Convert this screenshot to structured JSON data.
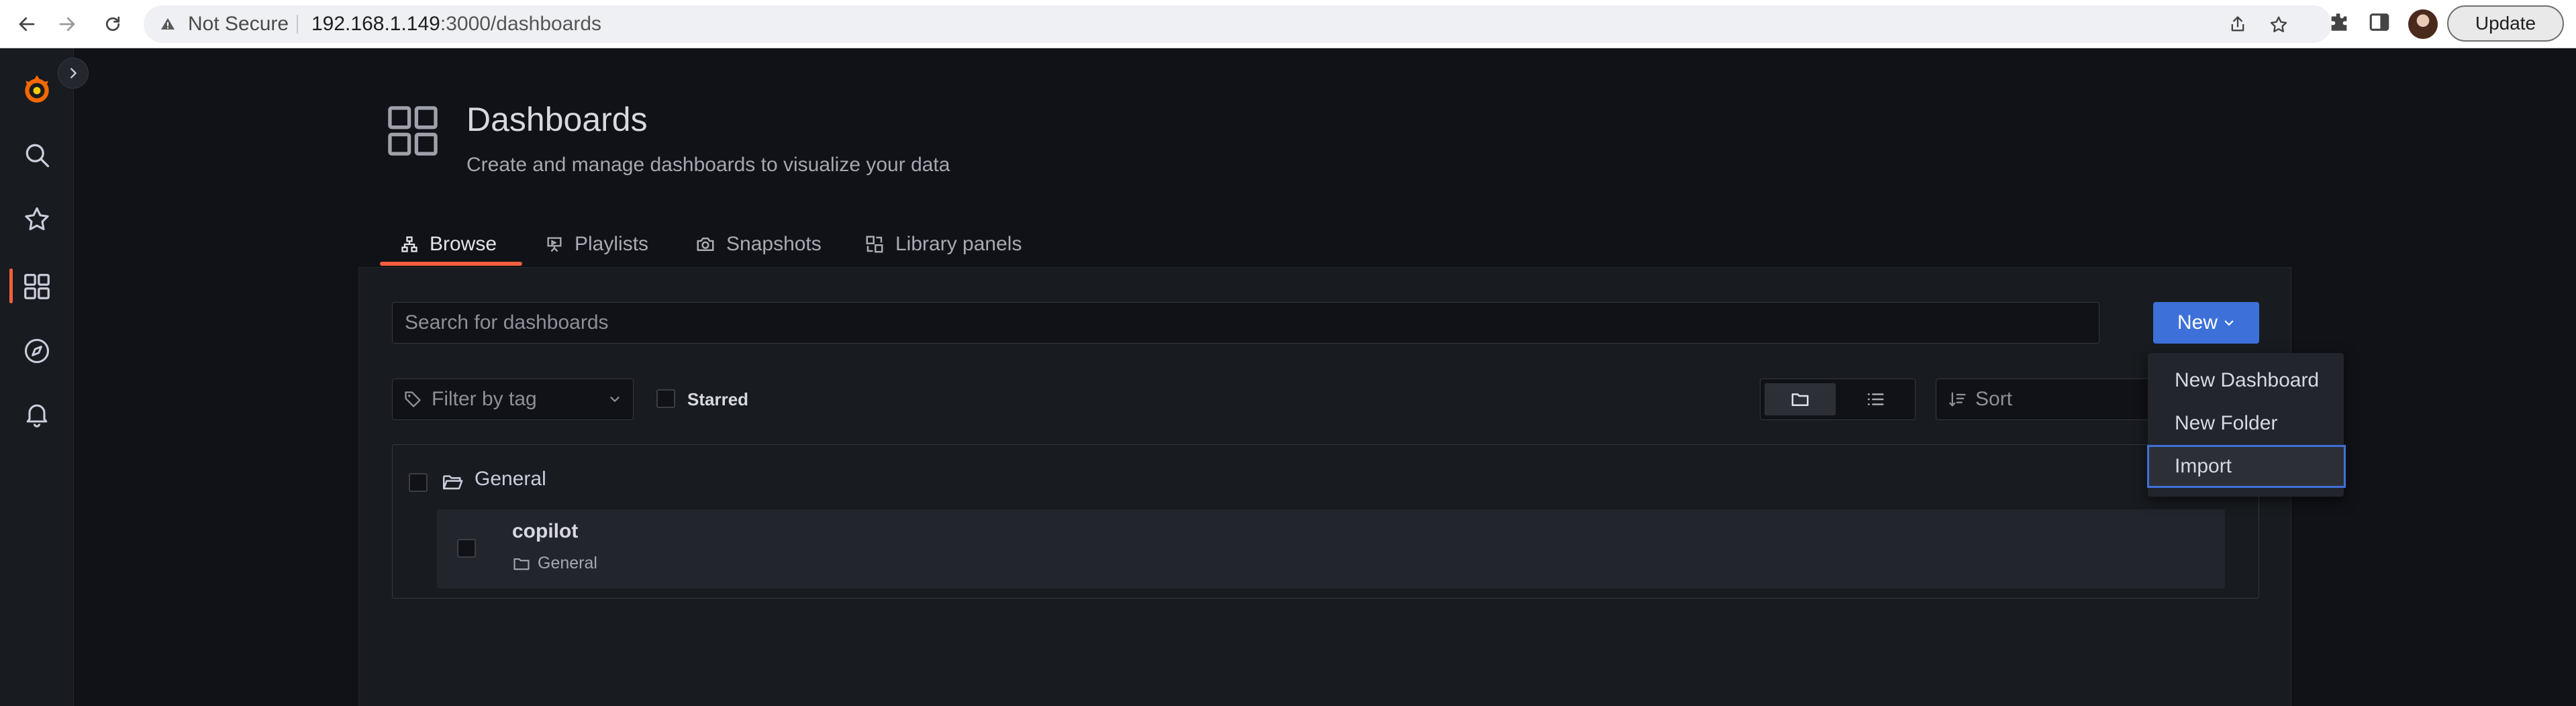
{
  "browser": {
    "security_label": "Not Secure",
    "url_host": "192.168.1.149",
    "url_path": ":3000/dashboards",
    "update_label": "Update",
    "icons": [
      "back-icon",
      "forward-icon",
      "reload-icon",
      "warning-icon",
      "share-icon",
      "star-icon",
      "extensions-icon",
      "sidepanel-icon",
      "profile-avatar"
    ]
  },
  "sidebar": {
    "items": [
      {
        "name": "grafana-logo"
      },
      {
        "name": "search"
      },
      {
        "name": "starred"
      },
      {
        "name": "dashboards",
        "active": true
      },
      {
        "name": "explore"
      },
      {
        "name": "alerting"
      }
    ],
    "accent_color": "#f55f3e"
  },
  "header": {
    "title": "Dashboards",
    "subtitle": "Create and manage dashboards to visualize your data"
  },
  "tabs": [
    {
      "label": "Browse",
      "active": true
    },
    {
      "label": "Playlists"
    },
    {
      "label": "Snapshots"
    },
    {
      "label": "Library panels"
    }
  ],
  "toolbar": {
    "search_placeholder": "Search for dashboards",
    "new_label": "New",
    "tag_filter_placeholder": "Filter by tag",
    "starred_label": "Starred",
    "sort_placeholder": "Sort",
    "view_mode": "folders"
  },
  "new_menu": {
    "items": [
      "New Dashboard",
      "New Folder",
      "Import"
    ],
    "focused": "Import"
  },
  "list": {
    "folder": "General",
    "dashboards": [
      {
        "title": "copilot",
        "folder": "General"
      }
    ]
  },
  "colors": {
    "background": "#111217",
    "panel": "#181b1f",
    "primary": "#3d71d9",
    "accent": "#f55f3e"
  }
}
